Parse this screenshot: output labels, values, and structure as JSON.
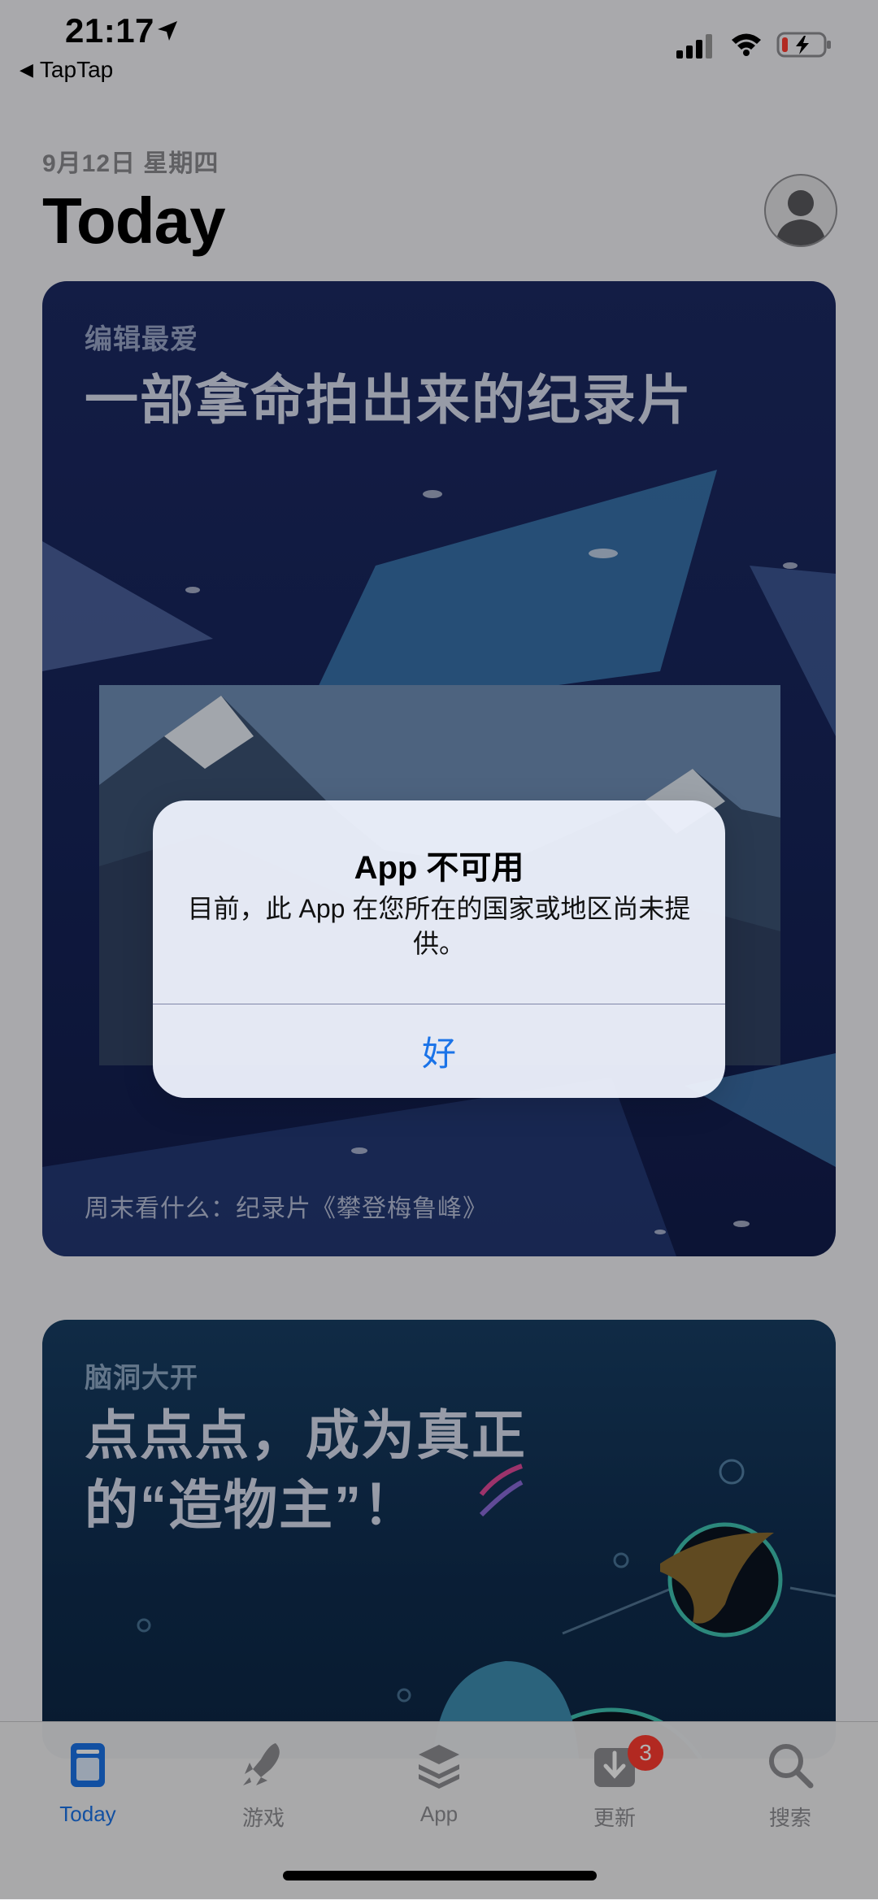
{
  "status_bar": {
    "time": "21:17",
    "back_app": "TapTap"
  },
  "header": {
    "date": "9月12日 星期四",
    "title": "Today"
  },
  "cards": [
    {
      "eyebrow": "编辑最爱",
      "title": "一部拿命拍出来的纪录片",
      "footer": "周末看什么：纪录片《攀登梅鲁峰》"
    },
    {
      "eyebrow": "脑洞大开",
      "title": "点点点，成为真正的“造物主”！"
    }
  ],
  "alert": {
    "title": "App 不可用",
    "message": "目前，此 App 在您所在的国家或地区尚未提供。",
    "button": "好"
  },
  "tab_bar": {
    "items": [
      {
        "label": "Today",
        "icon": "today-icon",
        "active": true
      },
      {
        "label": "游戏",
        "icon": "rocket-icon",
        "active": false
      },
      {
        "label": "App",
        "icon": "layers-icon",
        "active": false
      },
      {
        "label": "更新",
        "icon": "download-icon",
        "active": false,
        "badge": "3"
      },
      {
        "label": "搜索",
        "icon": "search-icon",
        "active": false
      }
    ]
  },
  "colors": {
    "accent": "#1a73e8",
    "badge": "#ff3b30",
    "card1_bg": "#1c2a63",
    "card2_bg": "#0f2c4e"
  }
}
